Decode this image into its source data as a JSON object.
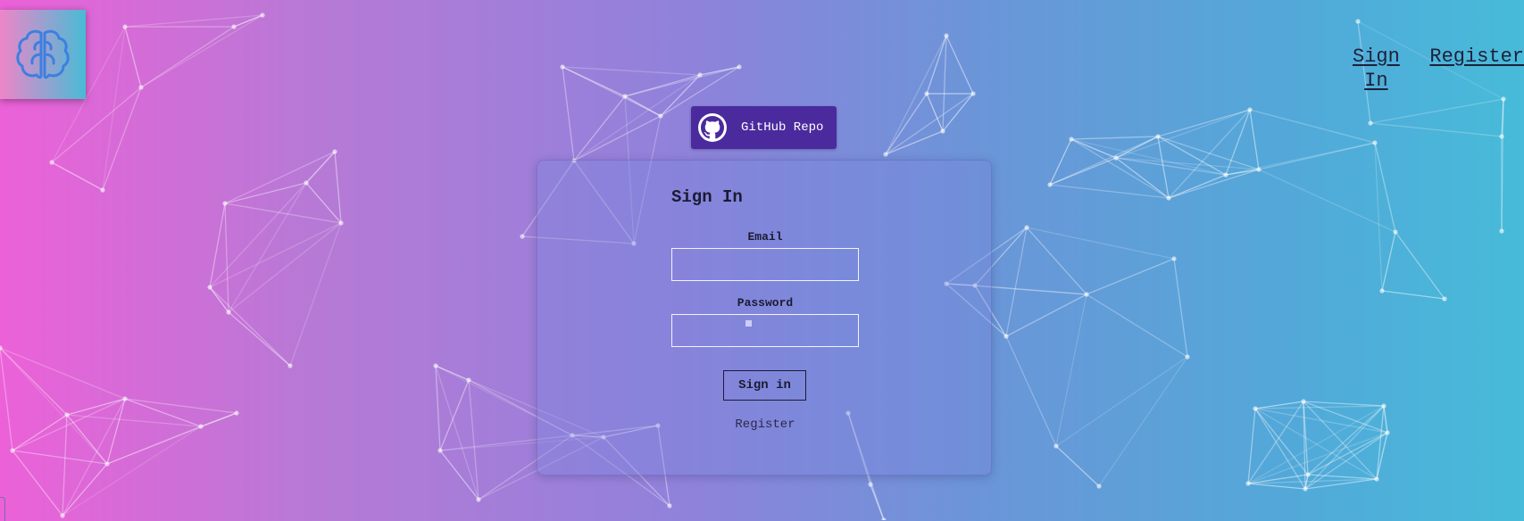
{
  "app": {
    "logo_icon": "brain-icon"
  },
  "nav": {
    "sign_in_line1": "Sign",
    "sign_in_line2": "In",
    "register": "Register"
  },
  "github": {
    "label": "GitHub Repo",
    "icon": "github-icon"
  },
  "form": {
    "title": "Sign In",
    "email_label": "Email",
    "email_value": "",
    "password_label": "Password",
    "password_value": "",
    "submit_label": "Sign in",
    "register_link": "Register"
  },
  "colors": {
    "gradient_left": "#ec61d8",
    "gradient_right": "#47bbd9",
    "github_button": "#4b2a9e",
    "logo_stroke": "#3d7fe0",
    "network_line": "#ffffff"
  }
}
